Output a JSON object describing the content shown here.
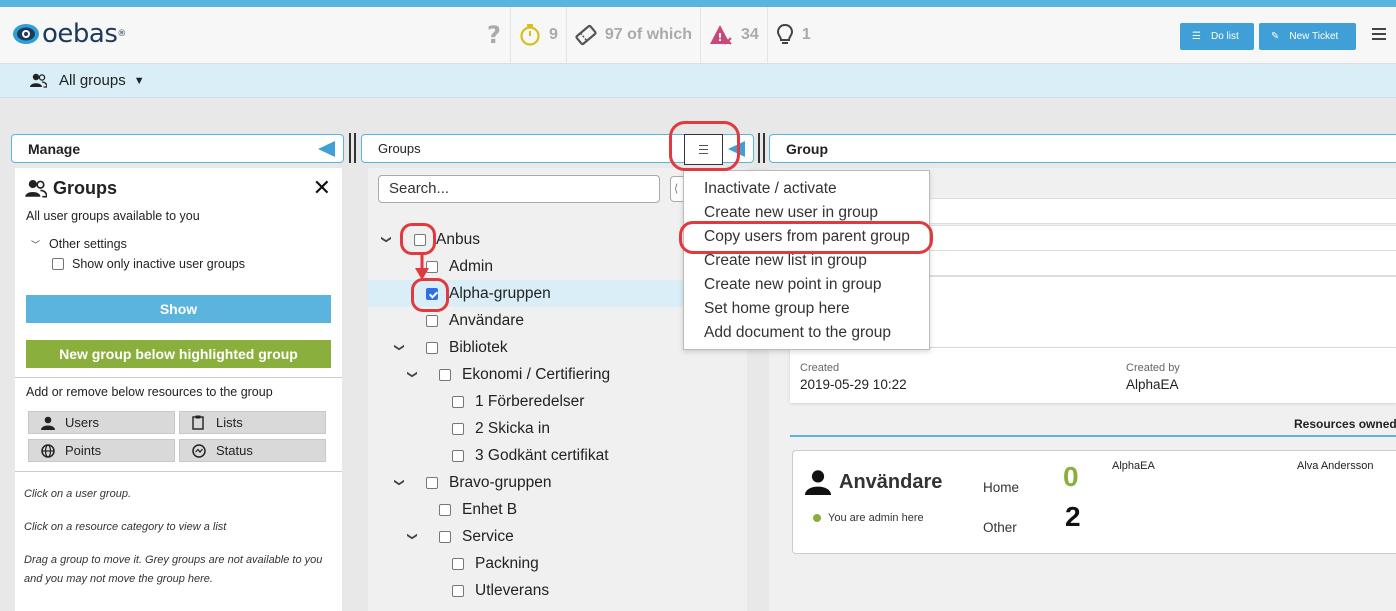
{
  "header": {
    "logo_text": "oebas",
    "logo_mark": "®",
    "stats": [
      {
        "icon": "question-icon",
        "value": ""
      },
      {
        "icon": "stopwatch-icon",
        "value": "9"
      },
      {
        "icon": "ticket-icon",
        "value": "97 of which"
      },
      {
        "icon": "warning-icon",
        "value": "34"
      },
      {
        "icon": "lightbulb-icon",
        "value": "1"
      }
    ],
    "do_list_label": "Do list",
    "new_ticket_label": "New Ticket"
  },
  "groupbar": {
    "label": "All groups"
  },
  "columns": {
    "manage": "Manage",
    "groups": "Groups",
    "group": "Group"
  },
  "left": {
    "title": "Groups",
    "description": "All user groups available to you",
    "other_settings": "Other settings",
    "inactive_label": "Show only inactive user groups",
    "show_button": "Show",
    "new_group_button": "New group below highlighted group",
    "add_remove": "Add or remove below resources to the group",
    "resources": [
      "Users",
      "Lists",
      "Points",
      "Status"
    ],
    "hints": [
      "Click on a user group.",
      "Click on a resource category to view a list",
      "Drag a group to move it. Grey groups are not available to you and you may not move the group here."
    ]
  },
  "middle": {
    "search_placeholder": "Search...",
    "tree": [
      {
        "label": "Anbus",
        "level": 0,
        "toggle": true,
        "checked": false
      },
      {
        "label": "Admin",
        "level": 1,
        "toggle": false,
        "checked": false
      },
      {
        "label": "Alpha-gruppen",
        "level": 1,
        "toggle": false,
        "checked": true,
        "highlighted": true
      },
      {
        "label": "Användare",
        "level": 1,
        "toggle": false,
        "checked": false
      },
      {
        "label": "Bibliotek",
        "level": 1,
        "toggle": true,
        "checked": false
      },
      {
        "label": "Ekonomi / Certifiering",
        "level": 2,
        "toggle": true,
        "checked": false
      },
      {
        "label": "1 Förberedelser",
        "level": 3,
        "toggle": false,
        "checked": false
      },
      {
        "label": "2 Skicka in",
        "level": 3,
        "toggle": false,
        "checked": false
      },
      {
        "label": "3 Godkänt certifikat",
        "level": 3,
        "toggle": false,
        "checked": false
      },
      {
        "label": "Bravo-gruppen",
        "level": 1,
        "toggle": true,
        "checked": false
      },
      {
        "label": "Enhet B",
        "level": 2,
        "toggle": false,
        "checked": false
      },
      {
        "label": "Service",
        "level": 2,
        "toggle": true,
        "checked": false
      },
      {
        "label": "Packning",
        "level": 3,
        "toggle": false,
        "checked": false
      },
      {
        "label": "Utleverans",
        "level": 3,
        "toggle": false,
        "checked": false
      }
    ]
  },
  "menu": {
    "items": [
      "Inactivate / activate",
      "Create new user in group",
      "Copy users from parent group",
      "Create new list in group",
      "Create new point in group",
      "Set home group here",
      "Add document to the group"
    ]
  },
  "right": {
    "created_label": "Created",
    "created_value": "2019-05-29 10:22",
    "created_by_label": "Created by",
    "created_by_value": "AlphaEA",
    "resources_owned": "Resources owned b",
    "card": {
      "title": "Användare",
      "admin_note": "You are admin here",
      "home_label": "Home",
      "home_count": "0",
      "other_label": "Other",
      "other_count": "2",
      "user1": "AlphaEA",
      "user2": "Alva Andersson"
    }
  },
  "colors": {
    "accent_blue": "#5ab4de",
    "button_blue": "#3f9fd6",
    "green": "#8aaf3c",
    "highlight_red": "#e0393e"
  }
}
